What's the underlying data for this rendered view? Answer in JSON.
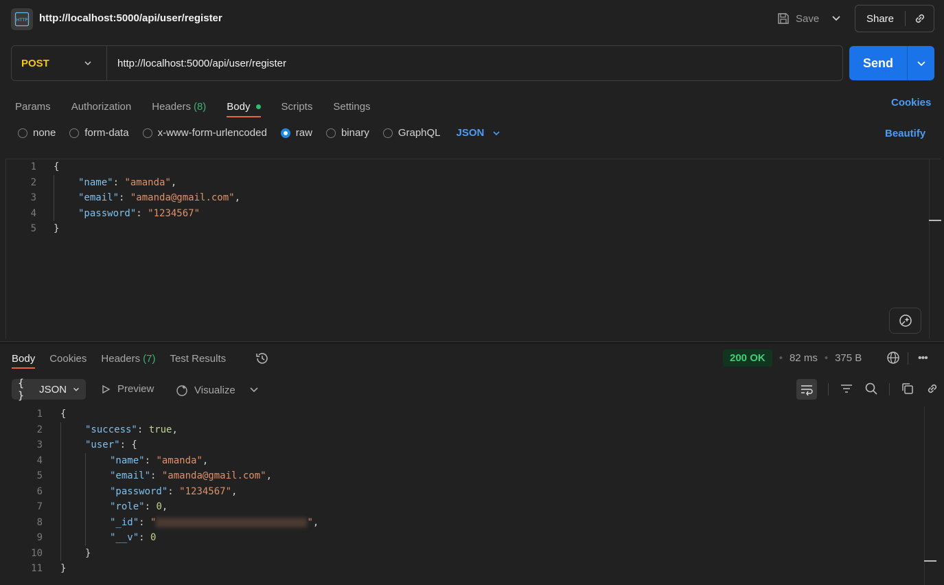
{
  "header": {
    "title": "http://localhost:5000/api/user/register",
    "save_label": "Save",
    "share_label": "Share"
  },
  "request": {
    "method": "POST",
    "url": "http://localhost:5000/api/user/register",
    "send_label": "Send",
    "tabs": [
      {
        "label": "Params"
      },
      {
        "label": "Authorization"
      },
      {
        "label": "Headers",
        "count": "(8)"
      },
      {
        "label": "Body"
      },
      {
        "label": "Scripts"
      },
      {
        "label": "Settings"
      }
    ],
    "active_tab": "Body",
    "cookies_label": "Cookies",
    "body_types": [
      "none",
      "form-data",
      "x-www-form-urlencoded",
      "raw",
      "binary",
      "GraphQL"
    ],
    "selected_body_type": "raw",
    "format": "JSON",
    "beautify_label": "Beautify",
    "body_lines": [
      {
        "n": "1",
        "text": "{"
      },
      {
        "n": "2",
        "key": "\"name\"",
        "value": "\"amanda\"",
        "suffix": ","
      },
      {
        "n": "3",
        "key": "\"email\"",
        "value": "\"amanda@gmail.com\"",
        "suffix": ","
      },
      {
        "n": "4",
        "key": "\"password\"",
        "value": "\"1234567\"",
        "suffix": ""
      },
      {
        "n": "5",
        "text": "}"
      }
    ]
  },
  "response": {
    "tabs": [
      {
        "label": "Body"
      },
      {
        "label": "Cookies"
      },
      {
        "label": "Headers",
        "count": "(7)"
      },
      {
        "label": "Test Results"
      }
    ],
    "status": "200 OK",
    "time": "82 ms",
    "size": "375 B",
    "format_label": "JSON",
    "preview_label": "Preview",
    "visualize_label": "Visualize",
    "lines": {
      "l1": "{",
      "success_key": "\"success\"",
      "success_val": "true",
      "user_key": "\"user\"",
      "name_key": "\"name\"",
      "name_val": "\"amanda\"",
      "email_key": "\"email\"",
      "email_val": "\"amanda@gmail.com\"",
      "password_key": "\"password\"",
      "password_val": "\"1234567\"",
      "role_key": "\"role\"",
      "role_val": "0",
      "id_key": "\"_id\"",
      "v_key": "\"__v\"",
      "v_val": "0",
      "close_inner": "}",
      "close_outer": "}"
    }
  }
}
